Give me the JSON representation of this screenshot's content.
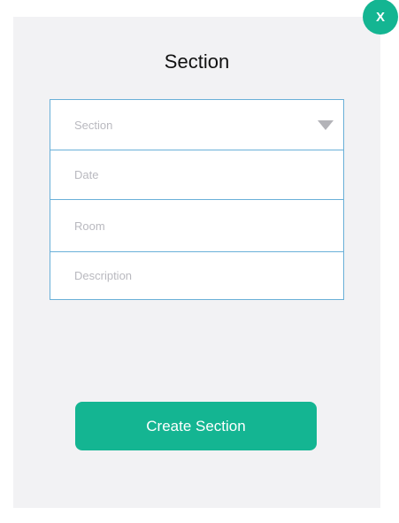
{
  "dialog": {
    "title": "Section",
    "close_label": "X"
  },
  "form": {
    "section_placeholder": "Section",
    "date_placeholder": "Date",
    "room_placeholder": "Room",
    "description_placeholder": "Description"
  },
  "actions": {
    "create_label": "Create Section"
  },
  "colors": {
    "accent": "#14b592",
    "field_border": "#6ab0d8",
    "panel_bg": "#f2f2f4",
    "placeholder": "#b9b9bf"
  }
}
